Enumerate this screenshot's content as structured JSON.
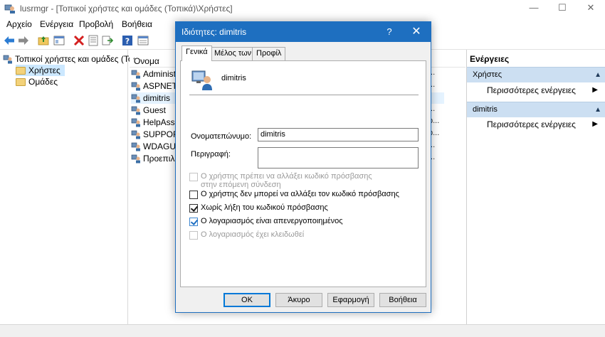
{
  "window": {
    "title": "lusrmgr - [Τοπικοί χρήστες και ομάδες (Τοπικά)\\Χρήστες]",
    "minimize": "—",
    "maximize": "☐",
    "close": "✕"
  },
  "menu": [
    "Αρχείο",
    "Ενέργεια",
    "Προβολή",
    "Βοήθεια"
  ],
  "tree": {
    "root": "Τοπικοί χρήστες και ομάδες (Το",
    "items": [
      "Χρήστες",
      "Ομάδες"
    ]
  },
  "list": {
    "column_name": "Όνομα",
    "rows": [
      {
        "name": "Administ",
        "trail": "..."
      },
      {
        "name": "ASPNET",
        "trail": "..."
      },
      {
        "name": "dimitris",
        "trail": ""
      },
      {
        "name": "Guest",
        "trail": "..."
      },
      {
        "name": "HelpAssis",
        "trail": "p..."
      },
      {
        "name": "SUPPORT",
        "trail": "p..."
      },
      {
        "name": "WDAGUti",
        "trail": "..."
      },
      {
        "name": "Προεπιλε",
        "trail": "..."
      }
    ]
  },
  "actions": {
    "title": "Ενέργειες",
    "sections": [
      {
        "label": "Χρήστες",
        "item": "Περισσότερες ενέργειες"
      },
      {
        "label": "dimitris",
        "item": "Περισσότερες ενέργειες"
      }
    ]
  },
  "dialog": {
    "title": "Ιδιότητες: dimitris",
    "help": "?",
    "close": "✕",
    "tabs": [
      "Γενικά",
      "Μέλος των",
      "Προφίλ"
    ],
    "username": "dimitris",
    "fullname_label": "Ονοματεπώνυμο:",
    "fullname_value": "dimitris",
    "description_label": "Περιγραφή:",
    "description_value": "",
    "checkboxes": [
      {
        "label1": "Ο χρήστης πρέπει να αλλάξει κωδικό πρόσβασης",
        "label2": "στην επόμενη σύνδεση",
        "checked": false,
        "disabled": true
      },
      {
        "label1": "Ο χρήστης δεν μπορεί να αλλάξει τον κωδικό πρόσβασης",
        "label2": "",
        "checked": false,
        "disabled": false
      },
      {
        "label1": "Χωρίς λήξη του κωδικού πρόσβασης",
        "label2": "",
        "checked": true,
        "disabled": false
      },
      {
        "label1": "Ο λογαριασμός είναι απενεργοποιημένος",
        "label2": "",
        "checked": true,
        "disabled": false
      },
      {
        "label1": "Ο λογαριασμός έχει κλειδωθεί",
        "label2": "",
        "checked": false,
        "disabled": true
      }
    ],
    "buttons": {
      "ok": "OK",
      "cancel": "Άκυρο",
      "apply": "Εφαρμογή",
      "help": "Βοήθεια"
    }
  },
  "colors": {
    "dialog_title_bar": "#1e6fc0",
    "action_section": "#ccdff2",
    "checkbox_accent": "#1f6fc2"
  },
  "icons": [
    "app-icon",
    "back-arrow-icon",
    "forward-arrow-icon",
    "folder-up-icon",
    "console-tree-icon",
    "delete-icon",
    "properties-icon",
    "export-icon",
    "help-icon",
    "view-icon",
    "folder-icon",
    "user-icon",
    "chevron-up-icon",
    "chevron-right-icon"
  ]
}
